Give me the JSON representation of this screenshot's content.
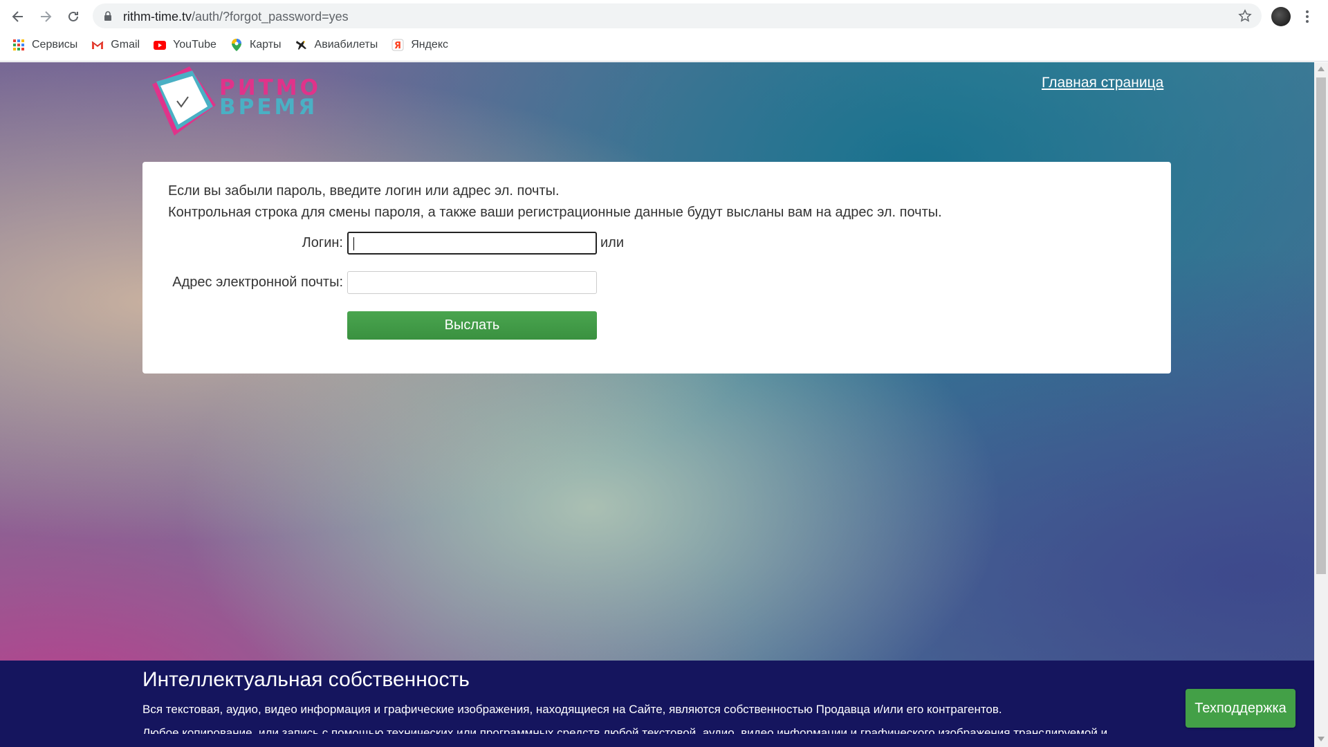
{
  "browser": {
    "url_host": "rithm-time.tv",
    "url_path": "/auth/?forgot_password=yes",
    "bookmarks": [
      {
        "label": "Сервисы",
        "icon": "apps-grid-icon"
      },
      {
        "label": "Gmail",
        "icon": "gmail-icon"
      },
      {
        "label": "YouTube",
        "icon": "youtube-icon"
      },
      {
        "label": "Карты",
        "icon": "maps-pin-icon"
      },
      {
        "label": "Авиабилеты",
        "icon": "airplane-icon"
      },
      {
        "label": "Яндекс",
        "icon": "yandex-icon"
      }
    ]
  },
  "header": {
    "logo_line1": "РИТМО",
    "logo_line2": "ВРЕМЯ",
    "home_link": "Главная страница"
  },
  "form": {
    "intro_line1": "Если вы забыли пароль, введите логин или адрес эл. почты.",
    "intro_line2": "Контрольная строка для смены пароля, а также ваши регистрационные данные будут высланы вам на адрес эл. почты.",
    "login_label": "Логин:",
    "login_value": "",
    "or_text": "или",
    "email_label": "Адрес электронной почты:",
    "email_value": "",
    "submit_label": "Выслать"
  },
  "footer": {
    "title": "Интеллектуальная собственность",
    "paragraph1": "Вся текстовая, аудио, видео информация и графические изображения, находящиеся на Сайте, являются собственностью Продавца и/или его контрагентов.",
    "paragraph2": "Любое копирование, или запись с помощью технических или программных средств любой текстовой, аудио, видео информации и графического изображения транслируемой и",
    "support_button": "Техподдержка"
  },
  "colors": {
    "accent_green": "#43a047",
    "footer_bg": "#15155e",
    "logo_pink": "#e0338a",
    "logo_teal": "#4ab0c4"
  }
}
